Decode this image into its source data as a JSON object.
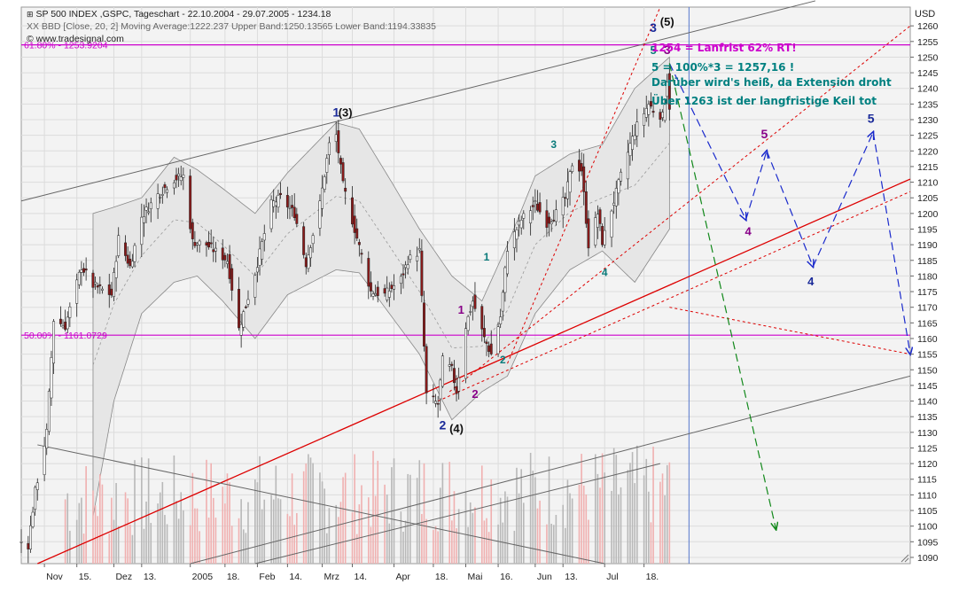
{
  "header": {
    "title_line": "SP 500 INDEX ,GSPC, Tageschart - 22.10.2004 - 29.07.2005 - 1234.18",
    "indicator_line": "XX BBD [Close, 20, 2] Moving Average:1222.237 Upper Band:1250.13565 Lower Band:1194.33835",
    "source_line": "© www.tradesignal.com",
    "currency": "USD"
  },
  "comments": [
    {
      "text": "1254 = Lanfrist 62% RT!",
      "color": "#cc00cc"
    },
    {
      "text": "5 = 100%*3 = 1257,16 !",
      "color": "#008080"
    },
    {
      "text": "Darüber wird's heiß, da Extension droht",
      "color": "#008080"
    },
    {
      "text": "Über 1263 ist der langfristige Keil tot",
      "color": "#008080"
    }
  ],
  "colors": {
    "up_candle": "#ffffff",
    "down_candle": "#8b1a1a",
    "fib_line": "#cc00cc",
    "trend_red": "#dd0000",
    "bollinger_fill": "#e6e6e6",
    "volume_up": "#b8b8b8",
    "volume_down": "#f0b0b0",
    "wave_blue": "#1a2a99",
    "wave_purple": "#880088",
    "wave_teal": "#0a7a7a",
    "projection_blue": "#1a2acc",
    "projection_green": "#11881a"
  },
  "chart_data": {
    "type": "candlestick",
    "y_axis": {
      "range": [
        1088,
        1266
      ],
      "ticks": [
        1090,
        1095,
        1100,
        1105,
        1110,
        1115,
        1120,
        1125,
        1130,
        1135,
        1140,
        1145,
        1150,
        1155,
        1160,
        1165,
        1170,
        1175,
        1180,
        1185,
        1190,
        1195,
        1200,
        1205,
        1210,
        1215,
        1220,
        1225,
        1230,
        1235,
        1240,
        1245,
        1250,
        1255,
        1260
      ],
      "position": "right"
    },
    "x_axis": {
      "range": [
        "2004-10-22",
        "2005-11-10"
      ],
      "ticks": [
        {
          "date": "2004-11-01",
          "label": "Nov"
        },
        {
          "date": "2004-11-15",
          "label": "15."
        },
        {
          "date": "2004-12-01",
          "label": "Dez"
        },
        {
          "date": "2004-12-13",
          "label": "13."
        },
        {
          "date": "2005-01-03",
          "label": "2005"
        },
        {
          "date": "2005-01-18",
          "label": "18."
        },
        {
          "date": "2005-02-01",
          "label": "Feb"
        },
        {
          "date": "2005-02-14",
          "label": "14."
        },
        {
          "date": "2005-03-01",
          "label": "Mrz"
        },
        {
          "date": "2005-03-14",
          "label": "14."
        },
        {
          "date": "2005-04-01",
          "label": "Apr"
        },
        {
          "date": "2005-04-18",
          "label": "18."
        },
        {
          "date": "2005-05-02",
          "label": "Mai"
        },
        {
          "date": "2005-05-16",
          "label": "16."
        },
        {
          "date": "2005-06-01",
          "label": "Jun"
        },
        {
          "date": "2005-06-13",
          "label": "13."
        },
        {
          "date": "2005-07-01",
          "label": "Jul"
        },
        {
          "date": "2005-07-18",
          "label": "18."
        }
      ]
    },
    "fib_levels": [
      {
        "label": "61.80% - 1253.9204",
        "value": 1253.9204
      },
      {
        "label": "50.00% - 1161.0729",
        "value": 1161.0729
      }
    ],
    "current_date_marker": "2005-07-29",
    "close_anchors": [
      {
        "date": "2004-10-22",
        "close": 1095
      },
      {
        "date": "2004-10-25",
        "close": 1094
      },
      {
        "date": "2004-10-28",
        "close": 1111
      },
      {
        "date": "2004-11-02",
        "close": 1130
      },
      {
        "date": "2004-11-05",
        "close": 1166
      },
      {
        "date": "2004-11-10",
        "close": 1164
      },
      {
        "date": "2004-11-17",
        "close": 1183
      },
      {
        "date": "2004-11-22",
        "close": 1177
      },
      {
        "date": "2004-11-30",
        "close": 1174
      },
      {
        "date": "2004-12-03",
        "close": 1192
      },
      {
        "date": "2004-12-08",
        "close": 1183
      },
      {
        "date": "2004-12-13",
        "close": 1199
      },
      {
        "date": "2004-12-20",
        "close": 1206
      },
      {
        "date": "2004-12-27",
        "close": 1211
      },
      {
        "date": "2004-12-31",
        "close": 1212
      },
      {
        "date": "2005-01-04",
        "close": 1191
      },
      {
        "date": "2005-01-10",
        "close": 1190
      },
      {
        "date": "2005-01-19",
        "close": 1185
      },
      {
        "date": "2005-01-24",
        "close": 1163
      },
      {
        "date": "2005-01-31",
        "close": 1181
      },
      {
        "date": "2005-02-07",
        "close": 1203
      },
      {
        "date": "2005-02-11",
        "close": 1205
      },
      {
        "date": "2005-02-17",
        "close": 1200
      },
      {
        "date": "2005-02-22",
        "close": 1184
      },
      {
        "date": "2005-02-28",
        "close": 1203
      },
      {
        "date": "2005-03-04",
        "close": 1222
      },
      {
        "date": "2005-03-07",
        "close": 1225
      },
      {
        "date": "2005-03-10",
        "close": 1209
      },
      {
        "date": "2005-03-15",
        "close": 1195
      },
      {
        "date": "2005-03-22",
        "close": 1175
      },
      {
        "date": "2005-03-28",
        "close": 1174
      },
      {
        "date": "2005-04-04",
        "close": 1179
      },
      {
        "date": "2005-04-07",
        "close": 1185
      },
      {
        "date": "2005-04-12",
        "close": 1188
      },
      {
        "date": "2005-04-15",
        "close": 1142
      },
      {
        "date": "2005-04-20",
        "close": 1139
      },
      {
        "date": "2005-04-22",
        "close": 1153
      },
      {
        "date": "2005-04-26",
        "close": 1150
      },
      {
        "date": "2005-04-28",
        "close": 1143
      },
      {
        "date": "2005-05-02",
        "close": 1164
      },
      {
        "date": "2005-05-05",
        "close": 1172
      },
      {
        "date": "2005-05-10",
        "close": 1160
      },
      {
        "date": "2005-05-13",
        "close": 1155
      },
      {
        "date": "2005-05-17",
        "close": 1167
      },
      {
        "date": "2005-05-20",
        "close": 1189
      },
      {
        "date": "2005-05-26",
        "close": 1198
      },
      {
        "date": "2005-06-01",
        "close": 1203
      },
      {
        "date": "2005-06-06",
        "close": 1197
      },
      {
        "date": "2005-06-10",
        "close": 1200
      },
      {
        "date": "2005-06-14",
        "close": 1205
      },
      {
        "date": "2005-06-17",
        "close": 1216
      },
      {
        "date": "2005-06-21",
        "close": 1214
      },
      {
        "date": "2005-06-24",
        "close": 1190
      },
      {
        "date": "2005-06-28",
        "close": 1200
      },
      {
        "date": "2005-06-30",
        "close": 1191
      },
      {
        "date": "2005-07-05",
        "close": 1204
      },
      {
        "date": "2005-07-08",
        "close": 1212
      },
      {
        "date": "2005-07-12",
        "close": 1222
      },
      {
        "date": "2005-07-15",
        "close": 1228
      },
      {
        "date": "2005-07-20",
        "close": 1235
      },
      {
        "date": "2005-07-22",
        "close": 1233
      },
      {
        "date": "2005-07-26",
        "close": 1231
      },
      {
        "date": "2005-07-27",
        "close": 1236
      },
      {
        "date": "2005-07-28",
        "close": 1243
      },
      {
        "date": "2005-07-29",
        "close": 1234.18
      }
    ],
    "bollinger_upper_anchors": [
      {
        "date": "2004-11-22",
        "value": 1200
      },
      {
        "date": "2004-12-01",
        "value": 1202
      },
      {
        "date": "2004-12-13",
        "value": 1205
      },
      {
        "date": "2004-12-27",
        "value": 1218
      },
      {
        "date": "2005-01-06",
        "value": 1214
      },
      {
        "date": "2005-01-17",
        "value": 1208
      },
      {
        "date": "2005-01-31",
        "value": 1200
      },
      {
        "date": "2005-02-14",
        "value": 1213
      },
      {
        "date": "2005-03-07",
        "value": 1229
      },
      {
        "date": "2005-03-17",
        "value": 1227
      },
      {
        "date": "2005-03-31",
        "value": 1210
      },
      {
        "date": "2005-04-12",
        "value": 1195
      },
      {
        "date": "2005-04-26",
        "value": 1180
      },
      {
        "date": "2005-05-09",
        "value": 1172
      },
      {
        "date": "2005-05-20",
        "value": 1190
      },
      {
        "date": "2005-06-01",
        "value": 1212
      },
      {
        "date": "2005-06-16",
        "value": 1219
      },
      {
        "date": "2005-06-30",
        "value": 1222
      },
      {
        "date": "2005-07-14",
        "value": 1240
      },
      {
        "date": "2005-07-29",
        "value": 1250
      }
    ],
    "bollinger_lower_anchors": [
      {
        "date": "2004-11-22",
        "value": 1103
      },
      {
        "date": "2004-12-01",
        "value": 1140
      },
      {
        "date": "2004-12-13",
        "value": 1168
      },
      {
        "date": "2004-12-27",
        "value": 1178
      },
      {
        "date": "2005-01-06",
        "value": 1180
      },
      {
        "date": "2005-01-17",
        "value": 1172
      },
      {
        "date": "2005-01-31",
        "value": 1160
      },
      {
        "date": "2005-02-14",
        "value": 1174
      },
      {
        "date": "2005-03-07",
        "value": 1182
      },
      {
        "date": "2005-03-17",
        "value": 1181
      },
      {
        "date": "2005-03-31",
        "value": 1167
      },
      {
        "date": "2005-04-12",
        "value": 1155
      },
      {
        "date": "2005-04-26",
        "value": 1134
      },
      {
        "date": "2005-05-09",
        "value": 1143
      },
      {
        "date": "2005-05-20",
        "value": 1148
      },
      {
        "date": "2005-06-01",
        "value": 1168
      },
      {
        "date": "2005-06-16",
        "value": 1182
      },
      {
        "date": "2005-06-30",
        "value": 1188
      },
      {
        "date": "2005-07-14",
        "value": 1178
      },
      {
        "date": "2005-07-29",
        "value": 1195
      }
    ],
    "trend_lines": [
      {
        "name": "Oberer Keil",
        "style": "solid-grey",
        "from": {
          "date": "2004-10-22",
          "value": 1204
        },
        "to": {
          "date": "2005-09-30",
          "value": 1268
        }
      },
      {
        "name": "Unterer Keil",
        "style": "solid-grey",
        "from": {
          "date": "2005-01-03",
          "value": 1088
        },
        "to": {
          "date": "2005-11-10",
          "value": 1148
        }
      },
      {
        "name": "Trendlinie",
        "style": "solid-red",
        "from": {
          "date": "2004-10-29",
          "value": 1088
        },
        "to": {
          "date": "2005-11-10",
          "value": 1211
        }
      },
      {
        "name": "Kanal 1",
        "style": "dashed-red",
        "from": {
          "date": "2005-04-20",
          "value": 1140
        },
        "to": {
          "date": "2005-11-10",
          "value": 1207
        }
      },
      {
        "name": "Kanal 2",
        "style": "dashed-red",
        "from": {
          "date": "2005-04-25",
          "value": 1143
        },
        "to": {
          "date": "2005-11-10",
          "value": 1260
        }
      },
      {
        "name": "Kanal 3",
        "style": "dashed-red",
        "from": {
          "date": "2005-05-20",
          "value": 1152
        },
        "to": {
          "date": "2005-07-25",
          "value": 1266
        }
      },
      {
        "name": "Kanal 4",
        "style": "dashed-red",
        "from": {
          "date": "2005-07-29",
          "value": 1170
        },
        "to": {
          "date": "2005-11-10",
          "value": 1155
        }
      },
      {
        "name": "Keil Volumen 1",
        "style": "solid-grey",
        "from": {
          "date": "2004-10-29",
          "value": 1126
        },
        "to": {
          "date": "2005-07-01",
          "value": 1088
        }
      },
      {
        "name": "Keil Volumen 2",
        "style": "solid-grey",
        "from": {
          "date": "2005-01-31",
          "value": 1088
        },
        "to": {
          "date": "2005-07-25",
          "value": 1120
        }
      }
    ],
    "projections": [
      {
        "color": "blue",
        "points": [
          {
            "date": "2005-07-29",
            "value": 1248
          },
          {
            "date": "2005-08-31",
            "value": 1198
          },
          {
            "date": "2005-09-09",
            "value": 1220
          },
          {
            "date": "2005-09-29",
            "value": 1183
          },
          {
            "date": "2005-10-25",
            "value": 1226
          },
          {
            "date": "2005-11-10",
            "value": 1155
          }
        ]
      },
      {
        "color": "green",
        "points": [
          {
            "date": "2005-07-29",
            "value": 1248
          },
          {
            "date": "2005-09-13",
            "value": 1099
          }
        ]
      }
    ],
    "wave_labels": [
      {
        "text": "1",
        "date": "2005-03-07",
        "value": 1231,
        "color": "blue",
        "size": 14
      },
      {
        "text": "(3)",
        "date": "2005-03-11",
        "value": 1231,
        "color": "black",
        "size": 13
      },
      {
        "text": "1",
        "date": "2005-04-30",
        "value": 1168,
        "color": "purple",
        "size": 13
      },
      {
        "text": "2",
        "date": "2005-05-06",
        "value": 1141,
        "color": "purple",
        "size": 13
      },
      {
        "text": "2",
        "date": "2005-04-22",
        "value": 1131,
        "color": "blue",
        "size": 14
      },
      {
        "text": "(4)",
        "date": "2005-04-28",
        "value": 1130,
        "color": "black",
        "size": 13
      },
      {
        "text": "1",
        "date": "2005-05-11",
        "value": 1185,
        "color": "teal",
        "size": 12
      },
      {
        "text": "2",
        "date": "2005-05-18",
        "value": 1152,
        "color": "teal",
        "size": 12
      },
      {
        "text": "3",
        "date": "2005-06-09",
        "value": 1221,
        "color": "teal",
        "size": 12
      },
      {
        "text": "4",
        "date": "2005-07-01",
        "value": 1180,
        "color": "teal",
        "size": 12
      },
      {
        "text": "3",
        "date": "2005-07-22",
        "value": 1258,
        "color": "blue",
        "size": 14
      },
      {
        "text": "(5)",
        "date": "2005-07-28",
        "value": 1260,
        "color": "black",
        "size": 13
      },
      {
        "text": "5",
        "date": "2005-07-22",
        "value": 1251,
        "color": "teal",
        "size": 13
      },
      {
        "text": "3",
        "date": "2005-07-28",
        "value": 1251,
        "color": "purple",
        "size": 14
      },
      {
        "text": "4",
        "date": "2005-09-01",
        "value": 1193,
        "color": "purple",
        "size": 13
      },
      {
        "text": "5",
        "date": "2005-09-08",
        "value": 1224,
        "color": "purple",
        "size": 14
      },
      {
        "text": "4",
        "date": "2005-09-28",
        "value": 1177,
        "color": "blue",
        "size": 13
      },
      {
        "text": "5",
        "date": "2005-10-24",
        "value": 1229,
        "color": "blue",
        "size": 14
      }
    ]
  }
}
